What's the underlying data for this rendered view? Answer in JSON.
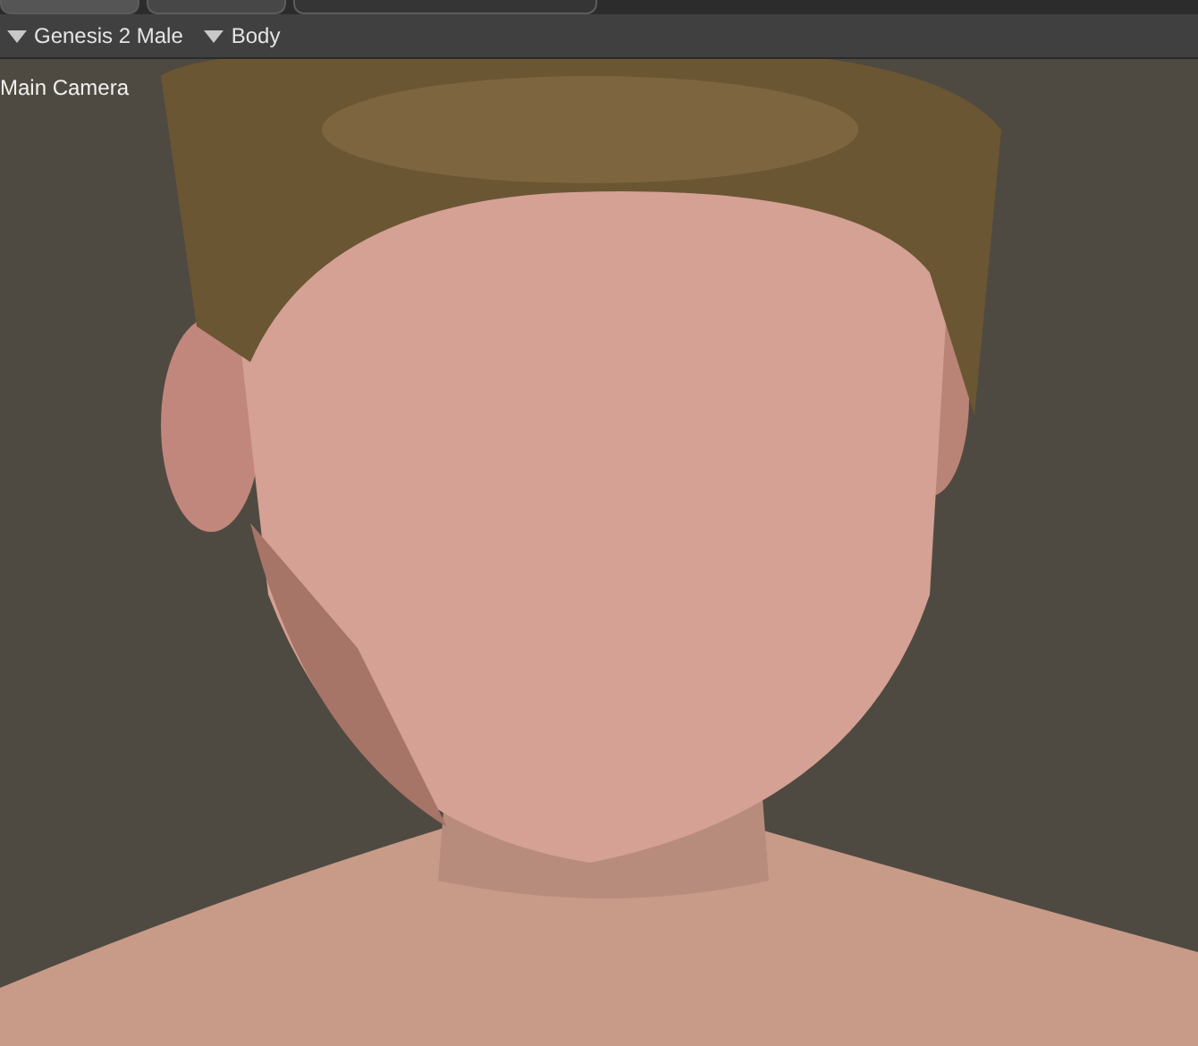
{
  "toolbar": {
    "menus": [
      {
        "label": "Genesis 2 Male"
      },
      {
        "label": "Body"
      }
    ]
  },
  "viewport": {
    "camera_label": "Main Camera"
  }
}
